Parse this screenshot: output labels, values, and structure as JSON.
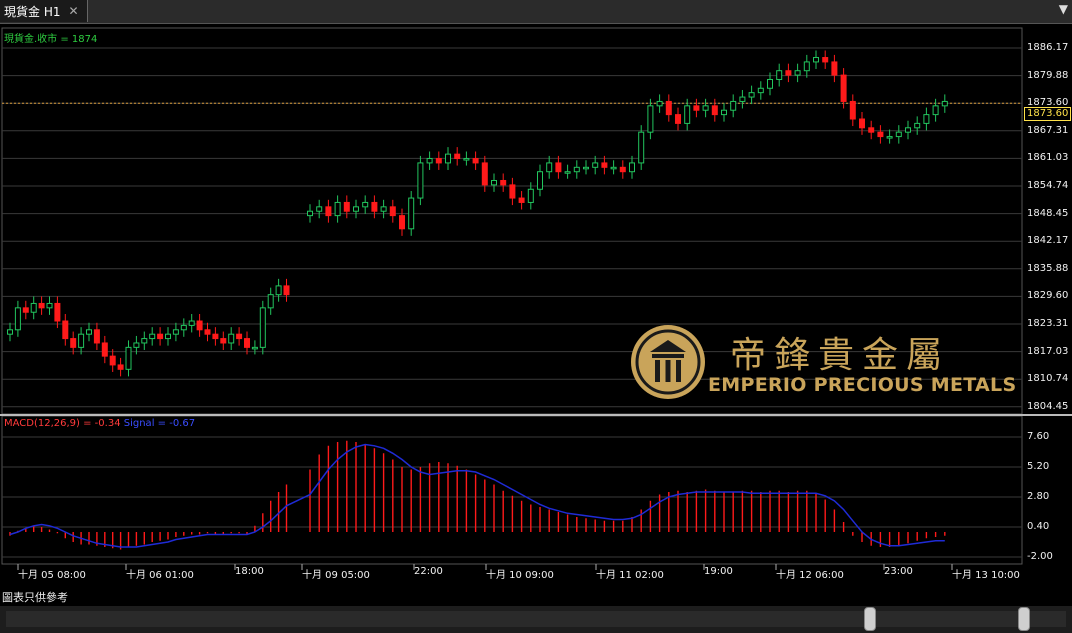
{
  "tab": {
    "title": "現貨金 H1",
    "close": "✕"
  },
  "menu_arrow": "▼",
  "main_legend": "現貨金.收市 = 1874",
  "price_badge": "1873.60",
  "y_labels": [
    "1886.17",
    "1879.88",
    "1873.60",
    "1867.31",
    "1861.03",
    "1854.74",
    "1848.45",
    "1842.17",
    "1835.88",
    "1829.60",
    "1823.31",
    "1817.03",
    "1810.74",
    "1804.45"
  ],
  "macd_y_labels": [
    "7.60",
    "5.20",
    "2.80",
    "0.40",
    "-2.00"
  ],
  "x_labels": [
    "十月 05 08:00",
    "十月 06 01:00",
    "18:00",
    "十月 09 05:00",
    "22:00",
    "十月 10 09:00",
    "十月 11 02:00",
    "19:00",
    "十月 12 06:00",
    "23:00",
    "十月 13 10:00"
  ],
  "macd_legend": {
    "macd": "MACD(12,26,9) = -0.34",
    "signal": "Signal = -0.67"
  },
  "footer_note": "圖表只供參考",
  "logo": {
    "chinese": "帝鋒貴金屬",
    "english": "EMPERIO PRECIOUS METALS"
  },
  "colors": {
    "up": "#22c55e",
    "down": "#ff1a1a",
    "signal": "#1f2bd6",
    "grid": "#3a3a3a",
    "price_line": "#d89a3a",
    "logo": "#c9a45a"
  },
  "chart_data": [
    {
      "type": "candlestick",
      "title": "現貨金 H1",
      "ylim": [
        1804.45,
        1888
      ],
      "price_line": 1873.6,
      "closes": [
        1822,
        1827,
        1826,
        1828,
        1827,
        1828,
        1824,
        1820,
        1818,
        1821,
        1822,
        1819,
        1816,
        1814,
        1813,
        1818,
        1819,
        1820,
        1821,
        1820,
        1821,
        1822,
        1823,
        1824,
        1822,
        1821,
        1820,
        1819,
        1821,
        1820,
        1818,
        1818,
        1827,
        1830,
        1832,
        1830,
        1849,
        1850,
        1848,
        1851,
        1849,
        1850,
        1851,
        1849,
        1850,
        1848,
        1845,
        1852,
        1860,
        1861,
        1860,
        1862,
        1861,
        1861,
        1860,
        1855,
        1856,
        1855,
        1852,
        1851,
        1854,
        1858,
        1860,
        1858,
        1858,
        1859,
        1859,
        1860,
        1859,
        1859,
        1858,
        1860,
        1867,
        1873,
        1874,
        1871,
        1869,
        1873,
        1872,
        1873,
        1871,
        1872,
        1874,
        1875,
        1876,
        1877,
        1879,
        1881,
        1880,
        1881,
        1883,
        1884,
        1883,
        1880,
        1874,
        1870,
        1868,
        1867,
        1866,
        1866,
        1867,
        1868,
        1869,
        1871,
        1873,
        1874
      ]
    },
    {
      "type": "bar+line",
      "title": "MACD(12,26,9)",
      "ylim": [
        -2.0,
        7.6
      ],
      "macd": [
        -0.3,
        0.1,
        0.3,
        0.5,
        0.4,
        0.2,
        -0.1,
        -0.5,
        -0.8,
        -1.0,
        -1.0,
        -1.1,
        -1.2,
        -1.3,
        -1.4,
        -1.2,
        -1.1,
        -1.0,
        -0.8,
        -0.7,
        -0.6,
        -0.4,
        -0.3,
        -0.2,
        -0.2,
        -0.1,
        -0.2,
        -0.2,
        -0.1,
        -0.1,
        -0.2,
        0.5,
        1.5,
        2.5,
        3.2,
        3.8,
        5.0,
        6.2,
        6.9,
        7.2,
        7.3,
        7.2,
        7.0,
        6.7,
        6.3,
        5.8,
        5.2,
        5.0,
        5.2,
        5.5,
        5.6,
        5.5,
        5.3,
        5.0,
        4.6,
        4.2,
        3.8,
        3.3,
        2.9,
        2.5,
        2.2,
        2.0,
        1.8,
        1.6,
        1.4,
        1.2,
        1.1,
        1.0,
        0.9,
        0.9,
        0.9,
        1.2,
        1.8,
        2.5,
        3.0,
        3.2,
        3.3,
        3.2,
        3.3,
        3.4,
        3.3,
        3.2,
        3.2,
        3.3,
        3.3,
        3.2,
        3.3,
        3.3,
        3.2,
        3.3,
        3.3,
        3.1,
        2.6,
        1.8,
        0.8,
        -0.3,
        -0.8,
        -1.1,
        -1.2,
        -1.2,
        -1.1,
        -0.9,
        -0.7,
        -0.5,
        -0.4,
        -0.3
      ],
      "signal": [
        -0.2,
        0.0,
        0.3,
        0.5,
        0.6,
        0.5,
        0.3,
        0.0,
        -0.3,
        -0.5,
        -0.7,
        -0.9,
        -1.0,
        -1.1,
        -1.2,
        -1.2,
        -1.2,
        -1.1,
        -1.0,
        -0.9,
        -0.8,
        -0.6,
        -0.5,
        -0.4,
        -0.3,
        -0.2,
        -0.2,
        -0.2,
        -0.2,
        -0.2,
        -0.2,
        0.0,
        0.4,
        0.9,
        1.5,
        2.1,
        3.0,
        4.0,
        5.0,
        5.8,
        6.4,
        6.8,
        7.0,
        6.9,
        6.7,
        6.3,
        5.8,
        5.2,
        4.8,
        4.6,
        4.7,
        4.8,
        4.9,
        4.9,
        4.8,
        4.5,
        4.2,
        3.8,
        3.4,
        3.0,
        2.6,
        2.2,
        1.9,
        1.7,
        1.5,
        1.4,
        1.3,
        1.2,
        1.1,
        1.0,
        1.0,
        1.1,
        1.4,
        1.9,
        2.4,
        2.8,
        3.0,
        3.1,
        3.2,
        3.2,
        3.2,
        3.2,
        3.2,
        3.2,
        3.1,
        3.1,
        3.1,
        3.1,
        3.1,
        3.1,
        3.1,
        3.1,
        2.9,
        2.5,
        1.8,
        0.9,
        0.0,
        -0.6,
        -0.9,
        -1.1,
        -1.1,
        -1.0,
        -0.9,
        -0.8,
        -0.7,
        -0.7
      ]
    }
  ]
}
